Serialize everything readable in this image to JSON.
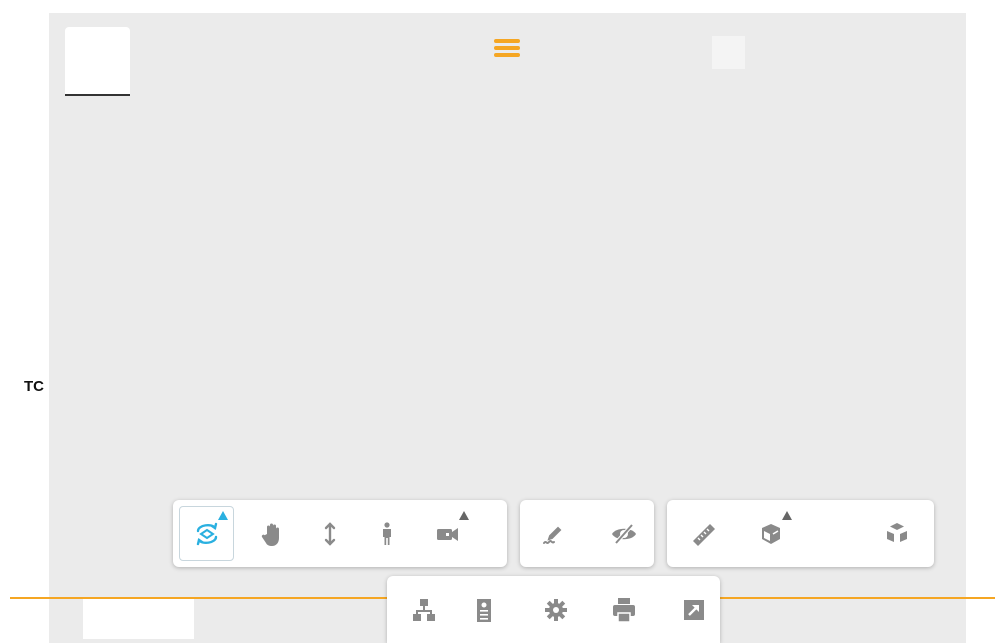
{
  "side_label": "TC",
  "colors": {
    "accent": "#f5a623",
    "active_tool": "#2ab0e0",
    "icon": "#8a8a8a",
    "viewer_bg": "#ebebeb"
  },
  "navigation_toolbar": [
    {
      "icon": "orbit-icon",
      "active": true,
      "has_flyout": true
    },
    {
      "icon": "pan-hand-icon"
    },
    {
      "icon": "zoom-arrows-icon"
    },
    {
      "icon": "first-person-icon"
    },
    {
      "icon": "camera-icon",
      "has_flyout": true
    }
  ],
  "markup_toolbar": [
    {
      "icon": "markup-pencil-icon"
    },
    {
      "icon": "hide-eye-icon"
    }
  ],
  "analysis_toolbar": [
    {
      "icon": "measure-ruler-icon"
    },
    {
      "icon": "section-box-icon",
      "has_flyout": true
    },
    {
      "icon": "explode-cube-icon"
    }
  ],
  "settings_toolbar": [
    {
      "icon": "model-browser-icon"
    },
    {
      "icon": "properties-icon"
    },
    {
      "icon": "settings-gear-icon"
    },
    {
      "icon": "print-icon"
    },
    {
      "icon": "fullscreen-icon"
    }
  ]
}
